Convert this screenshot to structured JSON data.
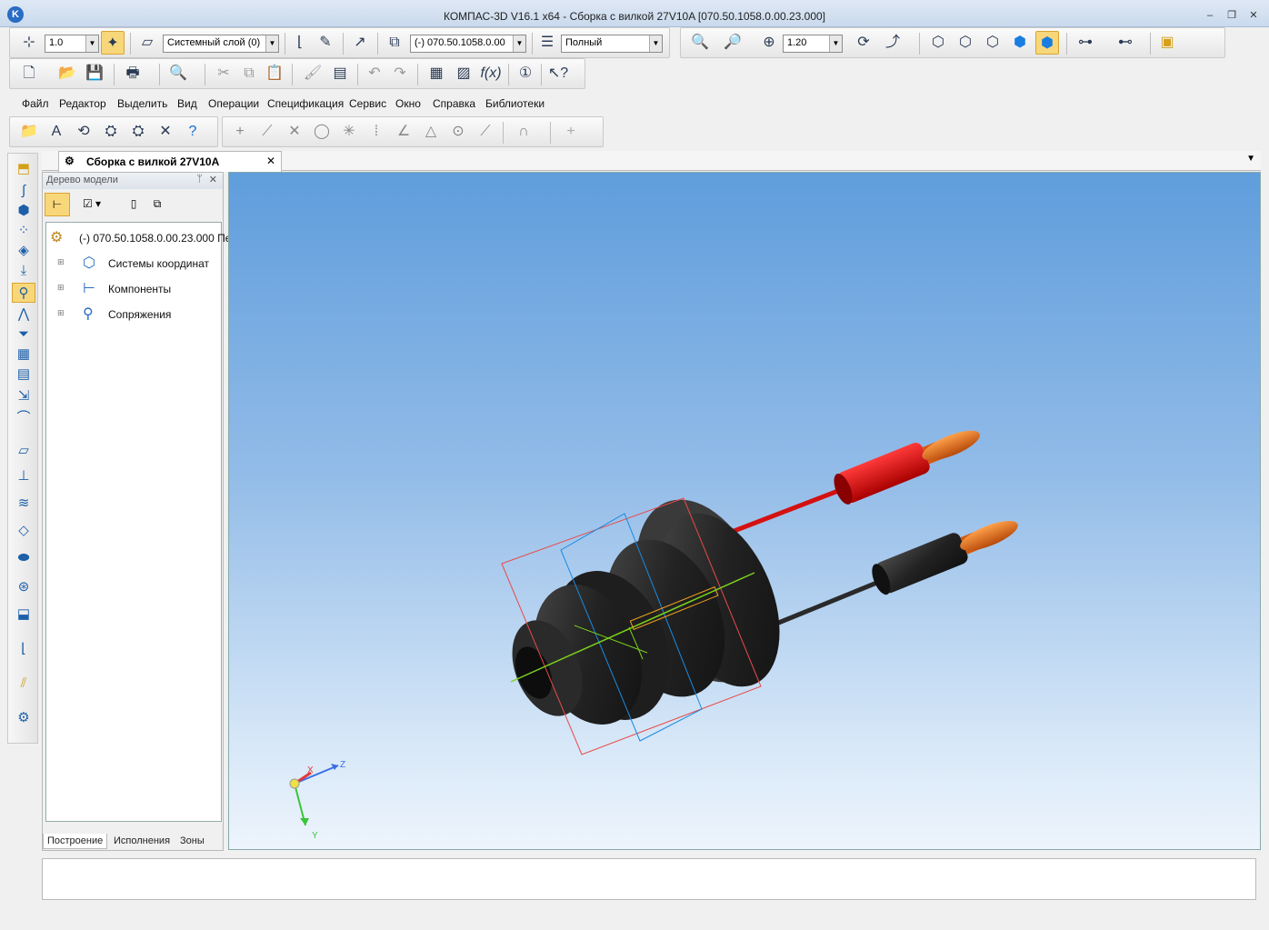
{
  "window": {
    "title": "КОМПАС-3D V16.1 x64 - Сборка с вилкой 27V10A [070.50.1058.0.00.23.000]",
    "logo": "K",
    "controls": [
      "–",
      "❐",
      "✕"
    ]
  },
  "toolbar1": {
    "step_value": "1.0",
    "layer_value": "Системный слой (0)",
    "part_value": "(-) 070.50.1058.0.00",
    "mode_value": "Полный",
    "zoom_value": "1.20"
  },
  "menu": {
    "items": [
      "Файл",
      "Редактор",
      "Выделить",
      "Вид",
      "Операции",
      "Спецификация",
      "Сервис",
      "Окно",
      "Справка",
      "Библиотеки"
    ]
  },
  "document": {
    "tab_label": "Сборка с вилкой 27V10A",
    "tab_close": "✕"
  },
  "tree_panel": {
    "title": "Дерево модели",
    "pin": "ᛘ",
    "close": "✕",
    "root": "(-) 070.50.1058.0.00.23.000 Пе",
    "items": [
      {
        "label": "Системы координат"
      },
      {
        "label": "Компоненты"
      },
      {
        "label": "Сопряжения"
      }
    ],
    "bottom_tabs": [
      "Построение",
      "Исполнения",
      "Зоны"
    ]
  },
  "triad": {
    "x": "X",
    "y": "Y",
    "z": "Z"
  },
  "colors": {
    "body": "#2b2b2b",
    "red_wire": "#d41111",
    "orange_tip": "#e0701a",
    "accent_active": "#f8d77a"
  }
}
